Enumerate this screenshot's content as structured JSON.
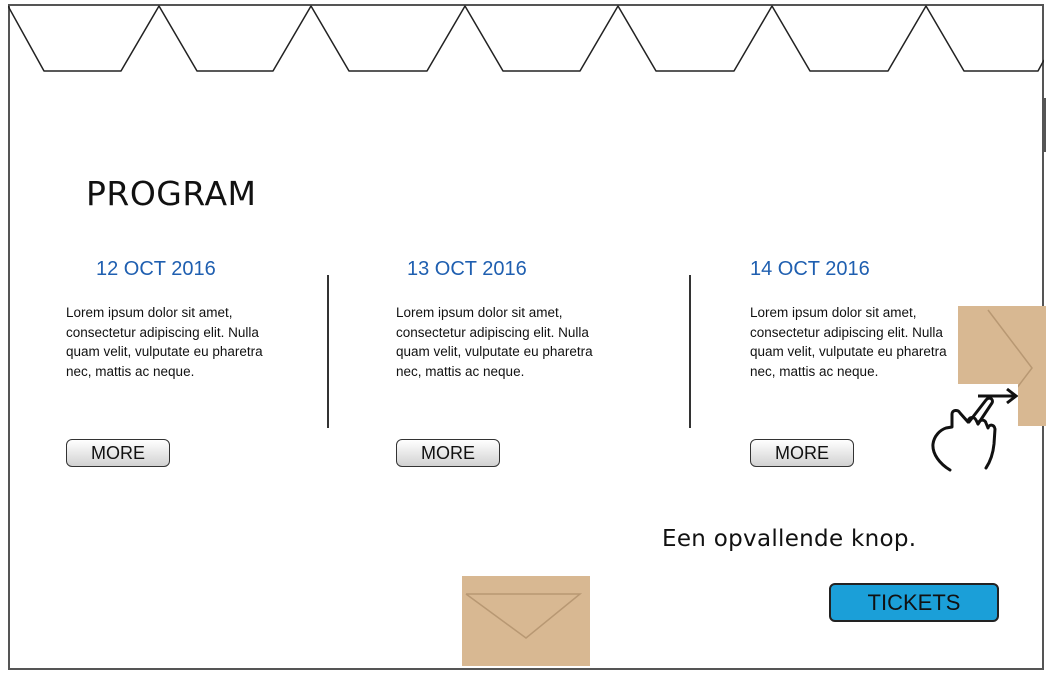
{
  "page": {
    "title": "PROGRAM",
    "callout": "Een opvallende knop.",
    "tickets_label": "TICKETS"
  },
  "program": [
    {
      "date": "12 OCT 2016",
      "text": "Lorem ipsum dolor sit amet, consectetur adipiscing elit. Nulla quam velit, vulputate eu pharetra nec, mattis ac neque.",
      "more_label": "MORE"
    },
    {
      "date": "13 OCT 2016",
      "text": "Lorem ipsum dolor sit amet, consectetur adipiscing elit. Nulla quam velit, vulputate eu pharetra nec, mattis ac neque.",
      "more_label": "MORE"
    },
    {
      "date": "14 OCT 2016",
      "text": "Lorem ipsum dolor sit amet, consectetur adipiscing elit. Nulla quam velit, vulputate eu pharetra nec, mattis ac neque.",
      "more_label": "MORE"
    }
  ],
  "icons": {
    "next": "chevron-right-icon",
    "gesture": "swipe-hand-icon",
    "down": "chevron-down-icon"
  },
  "colors": {
    "date": "#1f5fb0",
    "tickets": "#1b9fd8",
    "nav_overlay": "#d8b892"
  }
}
